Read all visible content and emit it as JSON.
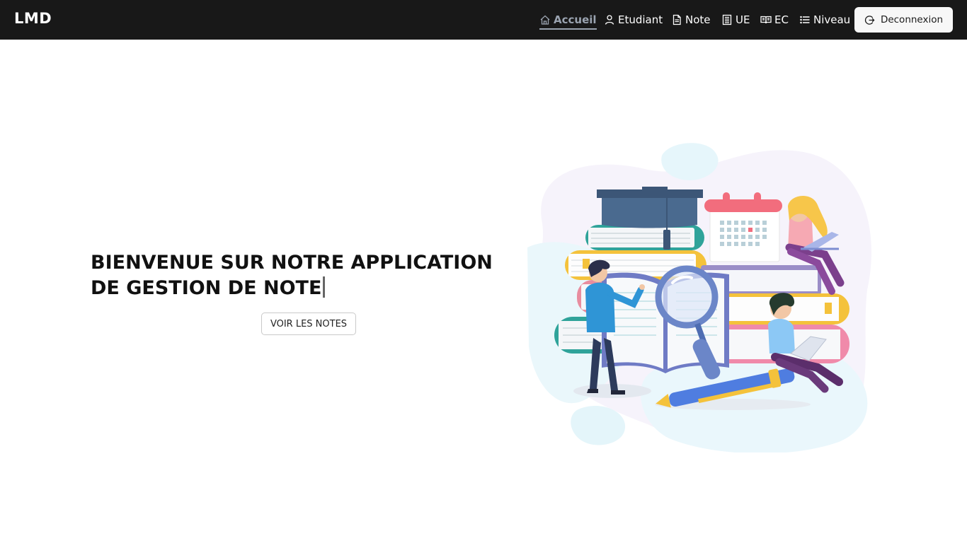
{
  "navbar": {
    "brand": "LMD",
    "items": [
      {
        "label": "Accueil",
        "icon": "home-icon",
        "active": true
      },
      {
        "label": "Etudiant",
        "icon": "user-icon",
        "active": false
      },
      {
        "label": "Note",
        "icon": "document-icon",
        "active": false
      },
      {
        "label": "UE",
        "icon": "building-icon",
        "active": false
      },
      {
        "label": "EC",
        "icon": "book-open-icon",
        "active": false
      },
      {
        "label": "Niveau",
        "icon": "list-icon",
        "active": false
      }
    ],
    "logout_label": "Deconnexion",
    "logout_icon": "logout-icon"
  },
  "hero": {
    "title": "BIENVENUE SUR NOTRE APPLICATION DE GESTION DE NOTE",
    "cta_label": "VOIR LES NOTES"
  },
  "colors": {
    "navbar_bg": "#181818",
    "active_nav": "#9aa3b0",
    "text_dark": "#111111"
  }
}
